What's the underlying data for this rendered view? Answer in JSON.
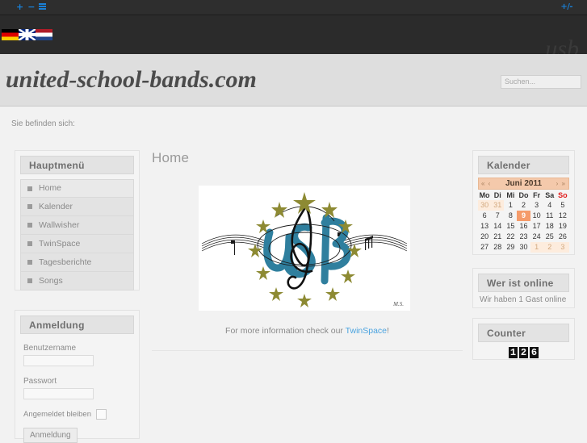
{
  "topbar": {
    "add_icon": "+",
    "minus_icon": "−",
    "menu_icon": "list-icon",
    "plusminus_label": "+/-"
  },
  "header": {
    "flags": [
      {
        "name": "flag-germany",
        "label": "Deutsch"
      },
      {
        "name": "flag-uk",
        "label": "English"
      },
      {
        "name": "flag-netherlands",
        "label": "Nederlands"
      }
    ],
    "watermark": "usb",
    "site_title": "united-school-bands.com",
    "search_placeholder": "Suchen...",
    "search_value": ""
  },
  "breadcrumb": {
    "label": "Sie befinden sich:"
  },
  "sidebar_left": {
    "mainmenu": {
      "title": "Hauptmenü",
      "items": [
        {
          "label": "Home"
        },
        {
          "label": "Kalender"
        },
        {
          "label": "Wallwisher"
        },
        {
          "label": "TwinSpace"
        },
        {
          "label": "Tagesberichte"
        },
        {
          "label": "Songs"
        }
      ]
    },
    "login": {
      "title": "Anmeldung",
      "username_label": "Benutzername",
      "username_value": "",
      "password_label": "Passwort",
      "password_value": "",
      "remember_label": "Angemeldet bleiben",
      "submit_label": "Anmeldung"
    }
  },
  "sidebar_right": {
    "calendar": {
      "title": "Kalender",
      "prev_label": "« ‹",
      "next_label": "› »",
      "month_label": "Juni 2011",
      "weekdays": [
        "Mo",
        "Di",
        "Mi",
        "Do",
        "Fr",
        "Sa",
        "So"
      ],
      "weeks": [
        [
          {
            "d": "30",
            "t": "out"
          },
          {
            "d": "31",
            "t": "out"
          },
          {
            "d": "1",
            "t": ""
          },
          {
            "d": "2",
            "t": ""
          },
          {
            "d": "3",
            "t": ""
          },
          {
            "d": "4",
            "t": ""
          },
          {
            "d": "5",
            "t": ""
          }
        ],
        [
          {
            "d": "6",
            "t": ""
          },
          {
            "d": "7",
            "t": ""
          },
          {
            "d": "8",
            "t": ""
          },
          {
            "d": "9",
            "t": "today"
          },
          {
            "d": "10",
            "t": ""
          },
          {
            "d": "11",
            "t": ""
          },
          {
            "d": "12",
            "t": ""
          }
        ],
        [
          {
            "d": "13",
            "t": ""
          },
          {
            "d": "14",
            "t": ""
          },
          {
            "d": "15",
            "t": ""
          },
          {
            "d": "16",
            "t": ""
          },
          {
            "d": "17",
            "t": ""
          },
          {
            "d": "18",
            "t": ""
          },
          {
            "d": "19",
            "t": ""
          }
        ],
        [
          {
            "d": "20",
            "t": ""
          },
          {
            "d": "21",
            "t": ""
          },
          {
            "d": "22",
            "t": ""
          },
          {
            "d": "23",
            "t": ""
          },
          {
            "d": "24",
            "t": ""
          },
          {
            "d": "25",
            "t": ""
          },
          {
            "d": "26",
            "t": ""
          }
        ],
        [
          {
            "d": "27",
            "t": ""
          },
          {
            "d": "28",
            "t": ""
          },
          {
            "d": "29",
            "t": ""
          },
          {
            "d": "30",
            "t": ""
          },
          {
            "d": "1",
            "t": "out"
          },
          {
            "d": "2",
            "t": "out"
          },
          {
            "d": "3",
            "t": "out"
          }
        ]
      ]
    },
    "online": {
      "title": "Wer ist online",
      "text": "Wir haben 1 Gast online"
    },
    "counter": {
      "title": "Counter",
      "digits": [
        "1",
        "2",
        "6"
      ]
    }
  },
  "main": {
    "page_title": "Home",
    "logo_alt": "usb-band-logo",
    "logo_signature": "M.S.",
    "info_text_before": "For more information check our ",
    "info_link": "TwinSpace",
    "info_text_after": "!"
  },
  "colors": {
    "accent_link": "#4aa3df",
    "topbar_icon": "#1a7fd4",
    "calendar_today": "#f59b6a",
    "calendar_header": "#f4c9ab",
    "sunday": "#e01b1b"
  }
}
